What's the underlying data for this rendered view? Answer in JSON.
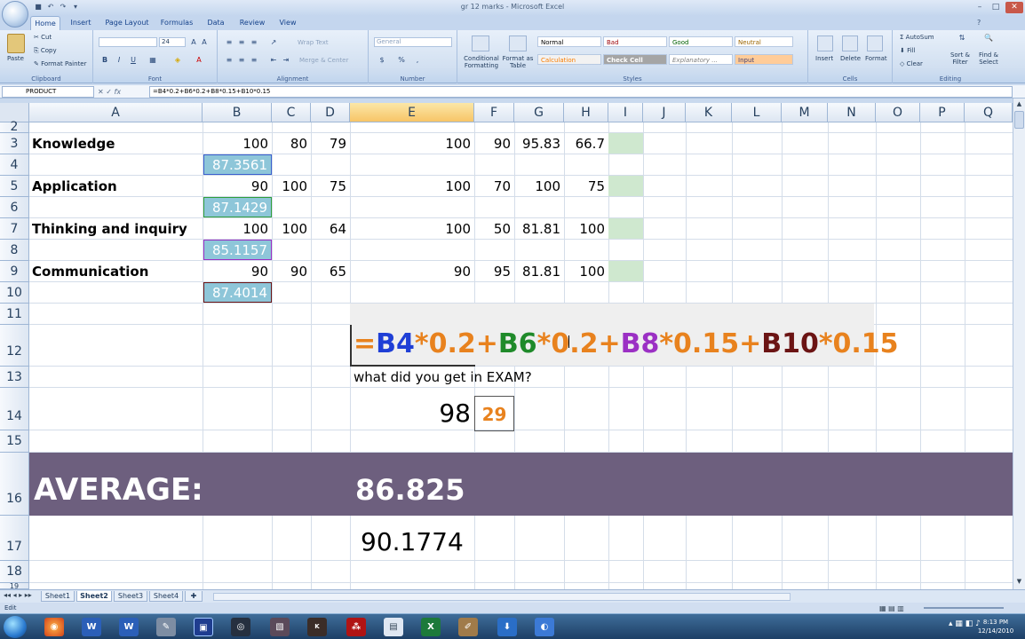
{
  "window": {
    "title": "gr 12 marks - Microsoft Excel"
  },
  "ribbon_tabs": [
    "Home",
    "Insert",
    "Page Layout",
    "Formulas",
    "Data",
    "Review",
    "View"
  ],
  "ribbon": {
    "clipboard": {
      "paste": "Paste",
      "cut": "Cut",
      "copy": "Copy",
      "format_painter": "Format Painter",
      "label": "Clipboard"
    },
    "font": {
      "size": "24",
      "label": "Font",
      "bold": "B",
      "italic": "I",
      "underline": "U"
    },
    "alignment": {
      "wrap": "Wrap Text",
      "merge": "Merge & Center",
      "label": "Alignment"
    },
    "number": {
      "format": "General",
      "currency": "$",
      "percent": "%",
      "comma": ",",
      "label": "Number"
    },
    "styles": {
      "conditional": "Conditional Formatting",
      "table": "Format as Table",
      "normal": "Normal",
      "bad": "Bad",
      "good": "Good",
      "neutral": "Neutral",
      "calculation": "Calculation",
      "check_cell": "Check Cell",
      "explanatory": "Explanatory ...",
      "input": "Input",
      "label": "Styles"
    },
    "cells": {
      "insert": "Insert",
      "delete": "Delete",
      "format": "Format",
      "label": "Cells"
    },
    "editing": {
      "autosum": "AutoSum",
      "fill": "Fill",
      "clear": "Clear",
      "sort": "Sort & Filter",
      "find": "Find & Select",
      "label": "Editing"
    }
  },
  "formula_bar": {
    "name_box": "PRODUCT",
    "fx": "fx",
    "formula": "=B4*0.2+B6*0.2+B8*0.15+B10*0.15"
  },
  "columns": [
    "A",
    "B",
    "C",
    "D",
    "E",
    "F",
    "G",
    "H",
    "I",
    "J",
    "K",
    "L",
    "M",
    "N",
    "O",
    "P",
    "Q"
  ],
  "rows": [
    "2",
    "3",
    "4",
    "5",
    "6",
    "7",
    "8",
    "9",
    "10",
    "11",
    "12",
    "13",
    "14",
    "15",
    "16",
    "17",
    "18",
    "19"
  ],
  "cells": {
    "a3": "Knowledge",
    "b3": "100",
    "c3": "80",
    "d3": "79",
    "e3": "100",
    "f3": "90",
    "g3": "95.83",
    "h3": "66.7",
    "b4": "87.3561",
    "a5": "Application",
    "b5": "90",
    "c5": "100",
    "d5": "75",
    "e5": "100",
    "f5": "70",
    "g5": "100",
    "h5": "75",
    "b6": "87.1429",
    "a7": "Thinking and inquiry",
    "b7": "100",
    "c7": "100",
    "d7": "64",
    "e7": "100",
    "f7": "50",
    "g7": "81.81",
    "h7": "100",
    "b8": "85.1157",
    "a9": "Communication",
    "b9": "90",
    "c9": "90",
    "d9": "65",
    "e9": "90",
    "f9": "95",
    "g9": "81.81",
    "h9": "100",
    "b10": "87.4014",
    "e13": "what did you get in EXAM?",
    "e14": "98",
    "f14": "29",
    "a16": "AVERAGE:",
    "e16": "86.825",
    "e17": "90.1774"
  },
  "formula_display": [
    {
      "text": "=",
      "color": "#e8821e"
    },
    {
      "text": "B4",
      "color": "#1f3fd6"
    },
    {
      "text": "*0.2+",
      "color": "#e8821e"
    },
    {
      "text": "B6",
      "color": "#1f8a2a"
    },
    {
      "text": "*0.2+",
      "color": "#e8821e"
    },
    {
      "text": "B8",
      "color": "#9b30c4"
    },
    {
      "text": "*0.15+",
      "color": "#e8821e"
    },
    {
      "text": "B10",
      "color": "#6b1414"
    },
    {
      "text": "*0.15",
      "color": "#e8821e"
    }
  ],
  "sheet_tabs": [
    "Sheet1",
    "Sheet2",
    "Sheet3",
    "Sheet4"
  ],
  "active_sheet": "Sheet2",
  "status": {
    "mode": "Edit"
  },
  "clock": {
    "time": "8:13 PM",
    "date": "12/14/2010"
  },
  "taskbar_icons": [
    "start-orb",
    "firefox",
    "word",
    "word-2",
    "paint",
    "media",
    "cam",
    "paint-2",
    "karaoke",
    "acrobat",
    "notepad",
    "excel",
    "pen",
    "download",
    "camtasia"
  ]
}
